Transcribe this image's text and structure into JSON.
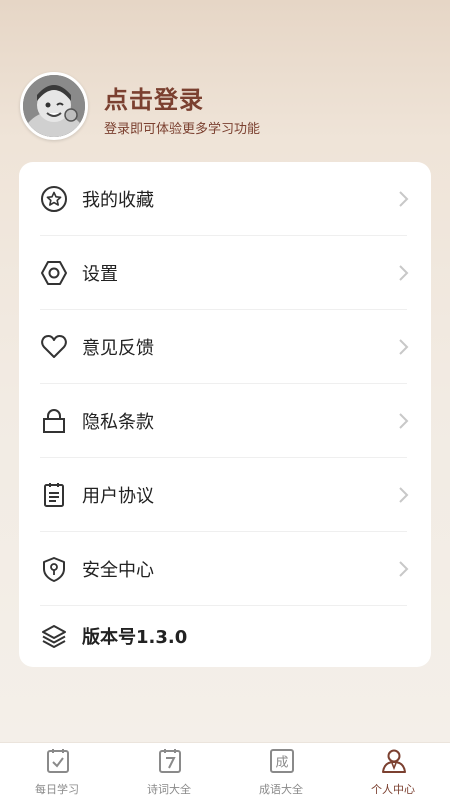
{
  "profile": {
    "title": "点击登录",
    "subtitle": "登录即可体验更多学习功能"
  },
  "menu": [
    {
      "label": "我的收藏",
      "icon": "star-circle-icon"
    },
    {
      "label": "设置",
      "icon": "hexagon-settings-icon"
    },
    {
      "label": "意见反馈",
      "icon": "heart-icon"
    },
    {
      "label": "隐私条款",
      "icon": "lock-icon"
    },
    {
      "label": "用户协议",
      "icon": "document-icon"
    },
    {
      "label": "安全中心",
      "icon": "shield-icon"
    }
  ],
  "version": {
    "label": "版本号1.3.0",
    "icon": "layers-icon"
  },
  "tabs": [
    {
      "label": "每日学习",
      "icon": "calendar-check-icon"
    },
    {
      "label": "诗词大全",
      "icon": "calendar-seven-icon"
    },
    {
      "label": "成语大全",
      "icon": "idiom-cheng-icon",
      "glyph": "成"
    },
    {
      "label": "个人中心",
      "icon": "person-icon",
      "active": true
    }
  ],
  "colors": {
    "accent": "#7b4030",
    "icon": "#333333",
    "chevron": "#c8c8c8",
    "inactive_tab": "#8a8a8a"
  }
}
